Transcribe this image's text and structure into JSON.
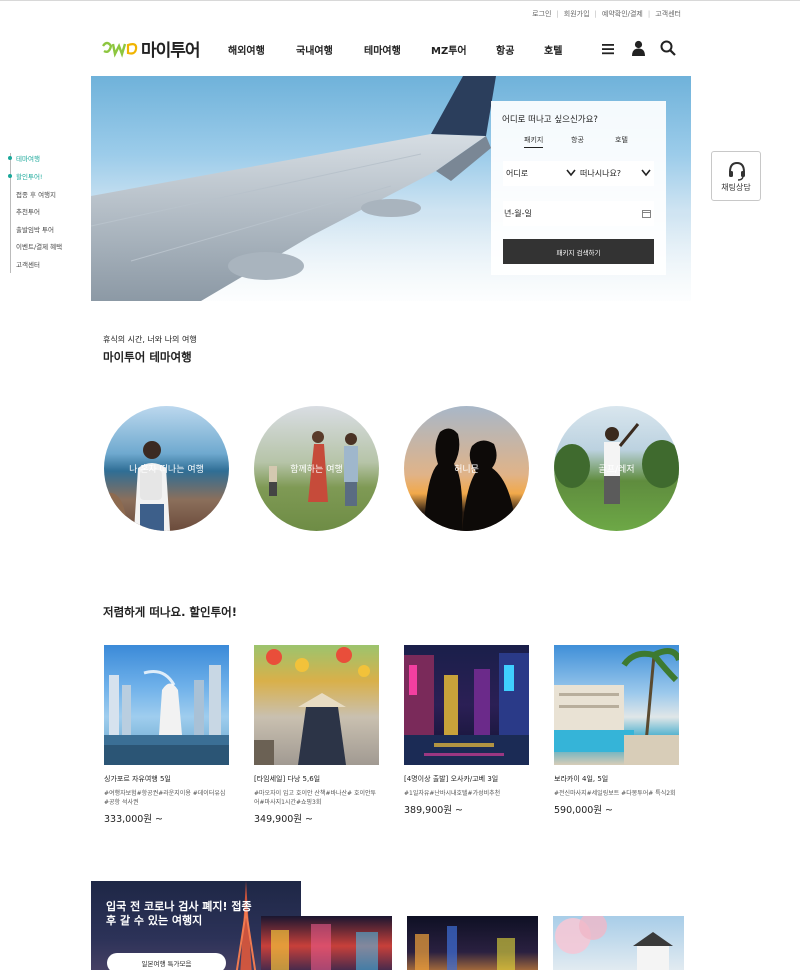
{
  "utility": {
    "items": [
      "로그인",
      "회원가입",
      "예약확인/결제",
      "고객센터"
    ]
  },
  "logo": {
    "text": "마이투어",
    "brand_color": "#8dc63f"
  },
  "gnb": {
    "items": [
      "해외여행",
      "국내여행",
      "테마여행",
      "MZ투어",
      "항공",
      "호텔"
    ]
  },
  "header_icons": [
    "menu-icon",
    "user-icon",
    "search-icon"
  ],
  "search_box": {
    "title": "어디로 떠나고 싶으신가요?",
    "tabs": [
      "패키지",
      "항공",
      "호텔"
    ],
    "active_tab": "패키지",
    "destination": "어디로",
    "departure": "떠나시나요?",
    "date_placeholder": "년-월-일",
    "submit": "패키지 검색하기"
  },
  "quick_menu": {
    "items": [
      "테마여행",
      "할인투어!",
      "접종 후 여행지",
      "추천투어",
      "출발임박 투어",
      "이벤트/결제 혜택",
      "고객센터"
    ],
    "accent": "#1aa89a"
  },
  "chat": {
    "label": "채팅상담"
  },
  "theme": {
    "subtitle": "휴식의 시간, 너와 나의 여행",
    "title": "마이투어 테마여행",
    "circles": [
      "나 혼자 떠나는 여행",
      "함께하는 여행",
      "허니문",
      "골프/레저"
    ]
  },
  "deals": {
    "title": "저렴하게 떠나요. 할인투어!",
    "cards": [
      {
        "title": "싱가포르 자유여행 5일",
        "tags": "#여행자보험#항공권#라운지이용 #데이터유심#공항 석사권",
        "price": "333,000원 ~"
      },
      {
        "title": "[타임세일] 다낭 5,6일",
        "tags": "#마오자이 입고 호이안 산책#바나산# 호이안투어#마사지1시간#쇼핑3회",
        "price": "349,900원 ~"
      },
      {
        "title": "[4명이상 출발] 오사카/고베 3일",
        "tags": "#1일자유#난바시내호텔#가성비추천",
        "price": "389,900원 ~"
      },
      {
        "title": "보라카이 4일, 5일",
        "tags": "#전신마사지#세일링보트 #다몽투어# 특식2회",
        "price": "590,000원 ~"
      }
    ]
  },
  "promo": {
    "title": "입국 전 코로나 검사 폐지! 접종 후 갈 수 있는 여행지",
    "button": "일본여행 특가모음"
  }
}
